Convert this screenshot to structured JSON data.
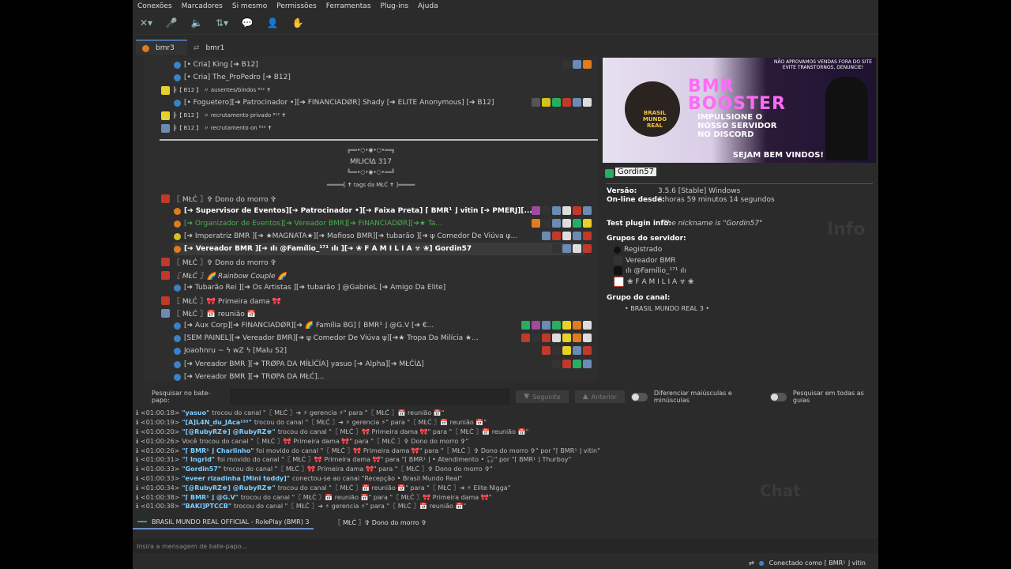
{
  "menu": [
    "Conexões",
    "Marcadores",
    "Si mesmo",
    "Permissões",
    "Ferramentas",
    "Plug-ins",
    "Ajuda"
  ],
  "tabs": [
    {
      "label": "bmr3",
      "active": true
    },
    {
      "label": "bmr1",
      "active": false
    }
  ],
  "tree": {
    "top_rows": [
      "[• Cria] King [➔ B12]",
      "[• Cria] The_ProPedro [➔ B12]",
      "╠【 B12 】 〃 ausentes/bindos ᴮ¹² ✝",
      "[• Foguetero][➔ Patrocinador •][➔ FINANCIADØR] Shady [➔ ELITE Anonymous] [➔ B12]",
      "╠【 B12 】 〃 recrutamento privado ᴮ¹² ✝",
      "╠【 B12 】 〃 recrutamento on ᴮ¹² ✝"
    ],
    "spacer_top": "╔══•○•◉•○•══╗",
    "milicia": "MłLłCłΔ 317",
    "spacer_bottom": "╚══•○•◉•○•══╝",
    "tags": "═════[ ✝ tags da MŁĆ ✝ ]═════",
    "rows": [
      "〖 MŁĆ 〗✞ Dono do morro ✞",
      "[➔ Supervisor de Eventos][➔ Patrocinador •][➔ Faixa Preta] ⌈ BMR¹ ⌋ vitin [➔ PMERJ][...",
      "[➔ Organizador de Eventos][➔ Vereador BMR][➔ FINANCIADØR][➔★ Ta...",
      "[➔ Imperatriz BMR ][➔ ★MAGNATA★][➔ Mafioso BMR][➔ tubarão ][➔ ψ Comedor De Viúva ψ...",
      "[➔ Vereador BMR ][➔ ılı @Famílio_¹⁷¹ ılı ][➔ ❀ F A M I L I A ☣ ❀] Gordin57",
      "〖 MŁĆ 〗✞ Dono do morro ✞",
      "〖 MŁĆ 〗🌈 Rainbow Couple 🌈",
      "[➔ Tubarão Rei ][➔ Os Artistas ][➔ tubarão ] @GabrieL [➔ Amigo Da Elite]",
      "〖 MŁĆ 〗🎀 Primeira dama 🎀",
      "〖 MŁĆ 〗📅 reunião 📅",
      "[➔ Aux Corp][➔ FINANCIADØR][➔ 🌈 Família BG] ⌈ BMR¹ ⌋      @G.V [➔ €...",
      "[SEM PAINEL][➔ Vereador BMR][➔ ψ Comedor De Viúva ψ][➔★ Tropa Da Milícia ★...",
      "Joaohnru ~ ϟ wZ ϟ [Malu S2]",
      "[➔ Vereador BMR ][➔ TRØPA DA ΜÍŁÍĆÍΑ] yasuo [➔ Alpha][➔ MŁĆÍΔ]",
      "[➔ Vereador BMR ][➔ TRØPA DA MŁĆ]..."
    ]
  },
  "banner": {
    "title_1": "BMR",
    "title_2": "BOOSTER",
    "subtitle": "IMPULSIONE O NOSSO SERVIDOR NO DISCORD",
    "bottom": "SEJAM BEM VINDOS!",
    "notice": "NÃO APROVAMOS VENDAS FORA DO SITE EVITE TRANSTORNOS, DENUNCIE!",
    "logo_text": "BRASIL MUNDO REAL"
  },
  "client_info": {
    "nickname": "Gordin57",
    "version_label": "Versão:",
    "version": "3.5.6 [Stable] Windows",
    "online_label": "On-line desde:",
    "online": "6 horas 59 minutos 14 segundos",
    "plugin_label": "Test plugin info:",
    "plugin_text": "The nickname is \"Gordin57\"",
    "groups_label": "Grupos do servidor:",
    "groups": [
      "Registrado",
      "Vereador BMR",
      "ılı @Famílio_¹⁷¹ ılı",
      "❀ F A M I L I A ☣ ❀"
    ],
    "channel_group_label": "Grupo do canal:",
    "channel_group": "• BRASIL MUNDO REAL 3 •"
  },
  "search": {
    "label": "Pesquisar no bate-papo:",
    "next": "Seguinte",
    "prev": "Anterior",
    "case_label": "Diferenciar maiúsculas e minúsculas",
    "all_tabs_label": "Pesquisar em todas as guias"
  },
  "log": [
    {
      "t": "<01:00:18>",
      "n": "\"yasuo\"",
      "msg": "trocou do canal \"〖 MŁĆ 〗➔ ⚡ gerencia ⚡\" para \"〖 MŁĆ 〗📅 reunião 📅\""
    },
    {
      "t": "<01:00:19>",
      "n": "\"[A]L4N_du_JAca¹⁵⁵\"",
      "msg": "trocou do canal \"〖 MŁĆ 〗➔ ⚡ gerencia ⚡\" para \"〖 MŁĆ 〗📅 reunião 📅\""
    },
    {
      "t": "<01:00:20>",
      "n": "\"[@RubyRZ♚] @RubyRZ♚\"",
      "msg": "trocou do canal \"〖 MŁĆ 〗🎀 Primeira dama 🎀\" para \"〖 MŁĆ 〗📅 reunião 📅\""
    },
    {
      "t": "<01:00:26>",
      "n": "Você",
      "msg": "trocou do canal \"〖 MŁĆ 〗🎀 Primeira dama 🎀\" para \"〖 MŁĆ 〗✞ Dono do morro ✞\""
    },
    {
      "t": "<01:00:26>",
      "n": "\"⌈ BMR¹ ⌋ Charlinho\"",
      "msg": "foi movido do canal \"〖 MŁĆ 〗🎀 Primeira dama 🎀\" para \"〖 MŁĆ 〗✞ Dono do morro ✞\" por \"⌈ BMR¹ ⌋ vitin\""
    },
    {
      "t": "<01:00:31>",
      "n": "\"!          Ingrid\"",
      "msg": "foi movido do canal \"〖 MŁĆ 〗🎀 Primeira dama 🎀\" para \"⌈ BMR¹ ⌋ • Atendimento • 🎧\" por \"⌈ BMR¹ ⌋ Thurboy\""
    },
    {
      "t": "<01:00:33>",
      "n": "\"Gordin57\"",
      "msg": "trocou do canal \"〖 MŁĆ 〗🎀 Primeira dama 🎀\" para \"〖 MŁĆ 〗✞ Dono do morro ✞\""
    },
    {
      "t": "<01:00:33>",
      "n": "\"eveer rizadinha [Mini toddy]\"",
      "msg": "conectou-se ao canal \"Recepção • Brasil Mundo Real\""
    },
    {
      "t": "<01:00:34>",
      "n": "\"[@RubyRZ♚] @RubyRZ♚\"",
      "msg": "trocou do canal \"〖 MŁĆ 〗📅 reunião 📅\" para \"〖 MŁĆ 〗➔ ⚡ Elite Nigga\""
    },
    {
      "t": "<01:00:38>",
      "n": "\"⌈ BMR¹ ⌋          @G.V\"",
      "msg": "trocou do canal \"〖 MŁĆ 〗📅 reunião 📅\" para \"〖 MŁĆ 〗🎀 Primeira dama 🎀\""
    },
    {
      "t": "<01:00:38>",
      "n": "\"BAKI]PTCCB\"",
      "msg": "trocou do canal \"〖 MŁĆ 〗➔ ⚡ gerencia ⚡\" para \"〖 MŁĆ 〗📅 reunião 📅\""
    }
  ],
  "chat_tabs": [
    {
      "label": "BRASIL MUNDO REAL OFFICIAL - RolePlay (BMR) 3",
      "active": true
    },
    {
      "label": "〖 MŁĆ 〗✞ Dono do morro ✞",
      "active": false
    }
  ],
  "input_placeholder": "Insira a mensagem de bate-papo...",
  "status": "Conectado como ⌈ BMR¹ ⌋ vitin",
  "watermarks": {
    "info": "Info",
    "chat": "Chat"
  },
  "colors": {
    "accent": "#4a6fa5",
    "name": "#7ecfff",
    "bg": "#2b2b2b"
  }
}
